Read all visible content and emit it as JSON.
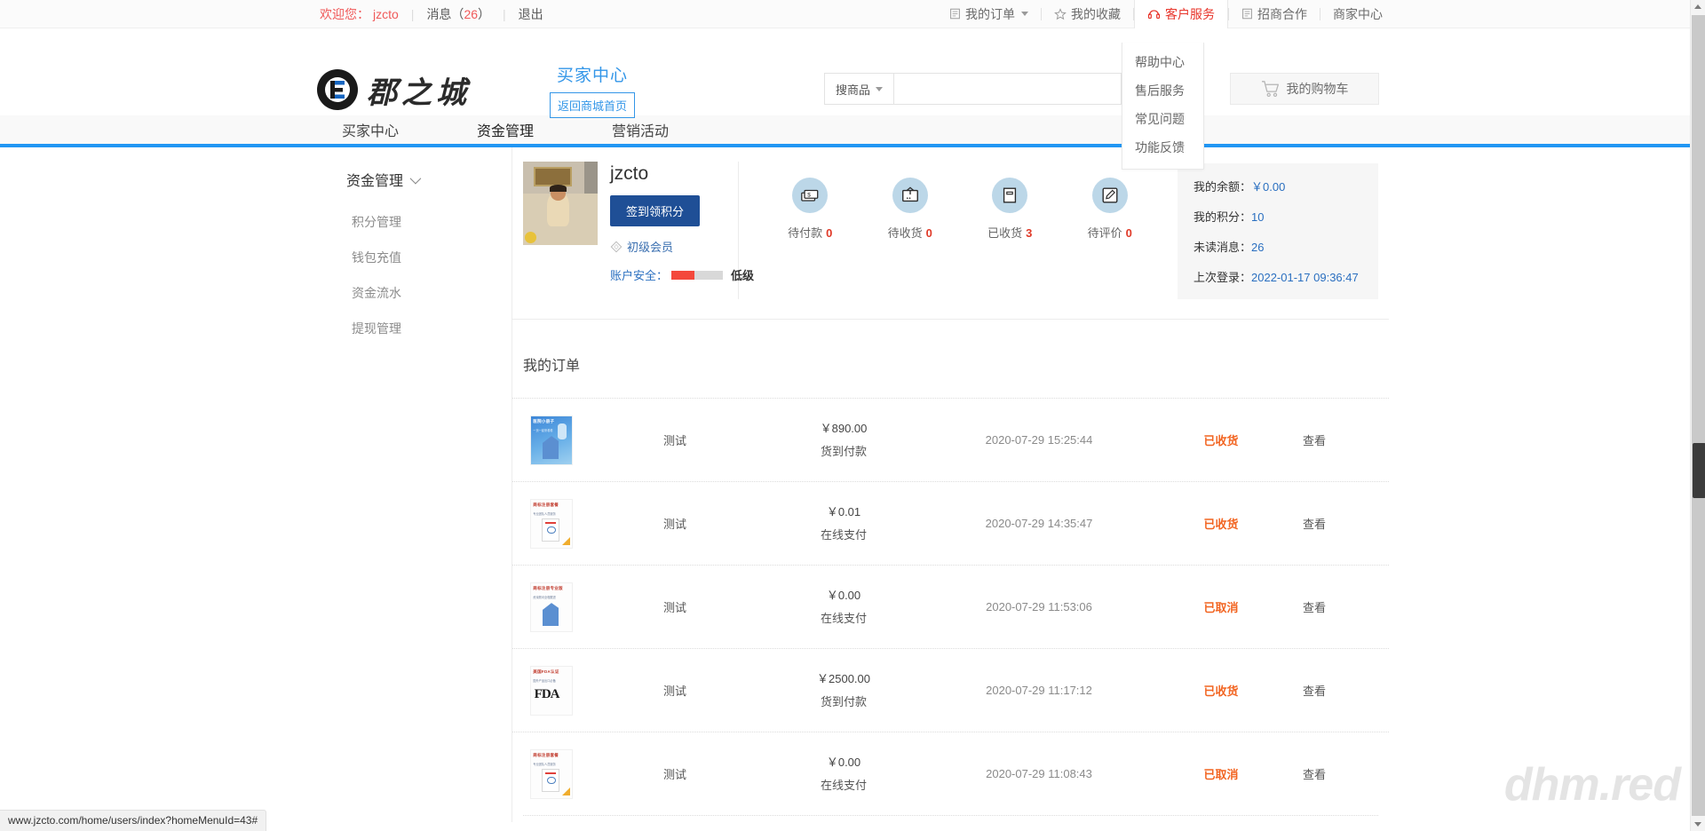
{
  "topbar": {
    "welcome": "欢迎您：",
    "username": "jzcto",
    "message_label": "消息（",
    "message_count": "26",
    "message_label_end": "）",
    "logout": "退出",
    "nav": [
      {
        "label": "我的订单",
        "icon": "list-icon",
        "has_caret": true
      },
      {
        "label": "我的收藏",
        "icon": "star-icon",
        "has_caret": false
      },
      {
        "label": "客户服务",
        "icon": "headset-icon",
        "has_caret": false
      },
      {
        "label": "招商合作",
        "icon": "list-icon",
        "has_caret": false
      },
      {
        "label": "商家中心",
        "icon": "none",
        "has_caret": false
      }
    ],
    "service_menu": [
      "帮助中心",
      "售后服务",
      "常见问题",
      "功能反馈"
    ]
  },
  "header": {
    "logo_text": "郡之城",
    "buyer_center_title": "买家中心",
    "back_to_mall": "返回商城首页",
    "search_category": "搜商品",
    "search_placeholder": "",
    "search_value": "",
    "cart_label": "我的购物车"
  },
  "mainnav": {
    "items": [
      "买家中心",
      "资金管理",
      "营销活动"
    ]
  },
  "sidebar": {
    "header": "资金管理",
    "items": [
      "积分管理",
      "钱包充值",
      "资金流水",
      "提现管理"
    ]
  },
  "profile": {
    "username": "jzcto",
    "signin_button": "签到领积分",
    "member_level": "初级会员",
    "security_label": "账户安全：",
    "security_level": "低级",
    "stats": [
      {
        "label": "待付款",
        "count": "0",
        "icon": "cash-icon"
      },
      {
        "label": "待收货",
        "count": "0",
        "icon": "box-icon"
      },
      {
        "label": "已收货",
        "count": "3",
        "icon": "package-icon"
      },
      {
        "label": "待评价",
        "count": "0",
        "icon": "edit-icon"
      }
    ],
    "account": [
      {
        "label": "我的余额：",
        "value": "￥0.00"
      },
      {
        "label": "我的积分：",
        "value": "10"
      },
      {
        "label": "未读消息：",
        "value": "26"
      },
      {
        "label": "上次登录：",
        "value": "2022-01-17 09:36:47"
      }
    ]
  },
  "orders": {
    "title": "我的订单",
    "rows": [
      {
        "thumb": "blue-brochure",
        "name": "测试",
        "price": "￥890.00",
        "pay_method": "货到付款",
        "date": "2020-07-29 15:25:44",
        "status": "已收货",
        "action": "查看"
      },
      {
        "thumb": "trademark-package",
        "name": "测试",
        "price": "￥0.01",
        "pay_method": "在线支付",
        "date": "2020-07-29 14:35:47",
        "status": "已收货",
        "action": "查看"
      },
      {
        "thumb": "trademark-pro",
        "name": "测试",
        "price": "￥0.00",
        "pay_method": "在线支付",
        "date": "2020-07-29 11:53:06",
        "status": "已取消",
        "action": "查看"
      },
      {
        "thumb": "fda-cert",
        "name": "测试",
        "price": "￥2500.00",
        "pay_method": "货到付款",
        "date": "2020-07-29 11:17:12",
        "status": "已收货",
        "action": "查看"
      },
      {
        "thumb": "trademark-package",
        "name": "测试",
        "price": "￥0.00",
        "pay_method": "在线支付",
        "date": "2020-07-29 11:08:43",
        "status": "已取消",
        "action": "查看"
      }
    ]
  },
  "watermark": "dhm.red",
  "statusbar": {
    "url": "www.jzcto.com/home/users/index?homeMenuId=43#"
  },
  "colors": {
    "accent_blue": "#2196f3",
    "brand_dark_blue": "#1f4f96",
    "alert_red": "#e8342a",
    "status_orange": "#f26522",
    "link_blue": "#2a6fc0"
  }
}
